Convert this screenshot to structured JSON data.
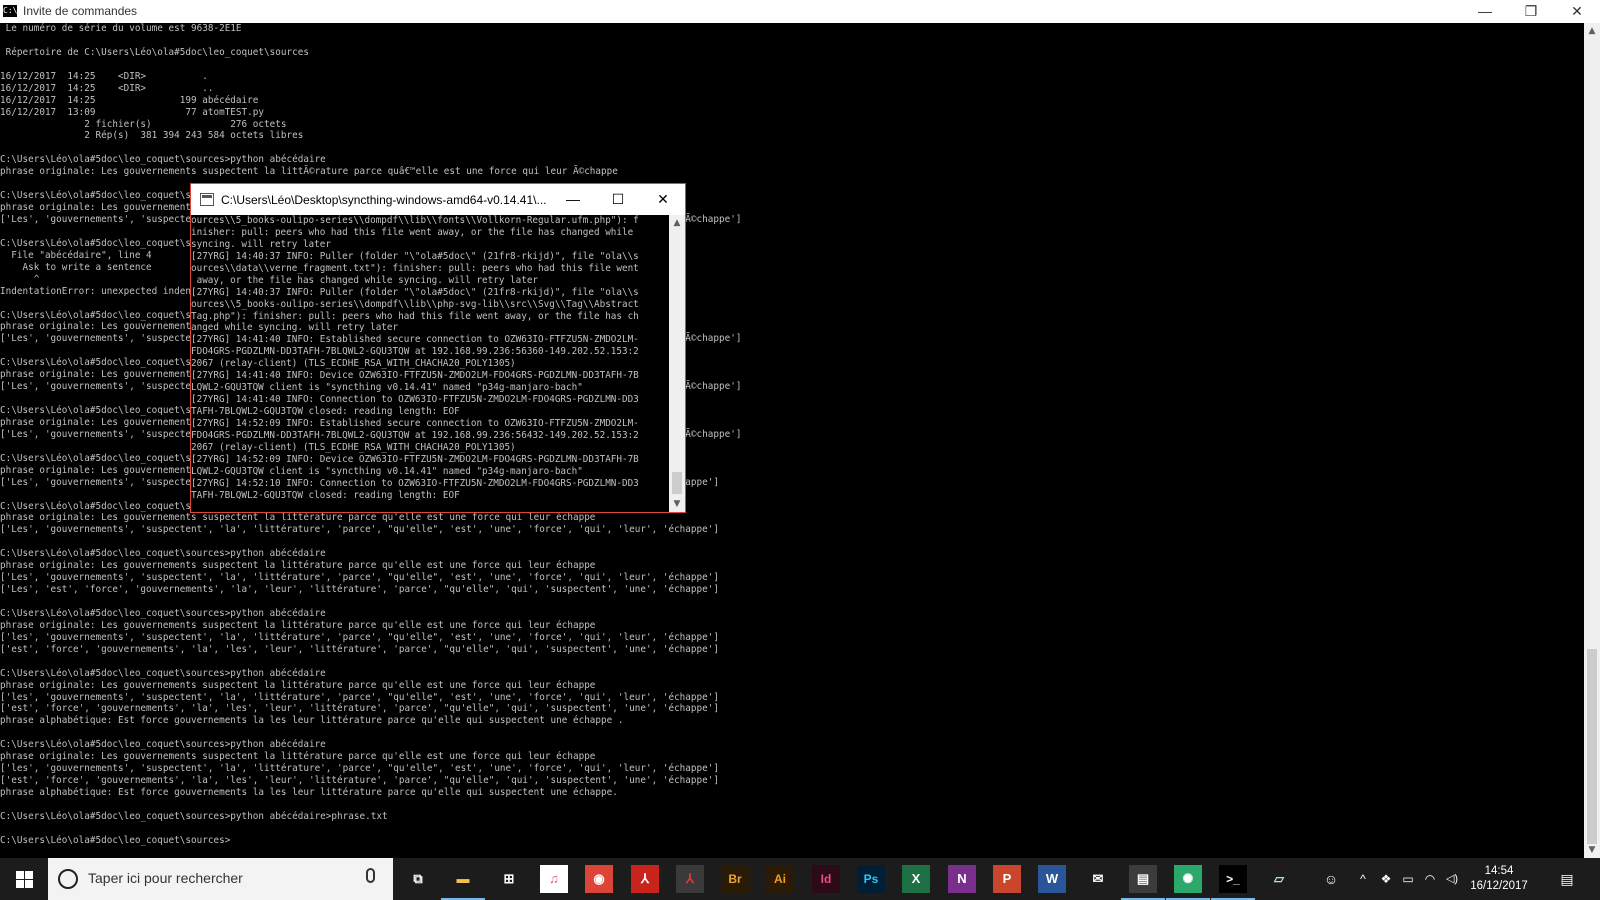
{
  "window": {
    "title": "Invite de commandes",
    "app_icon_label": "C:\\",
    "minimize_glyph": "—",
    "restore_glyph": "❐",
    "close_glyph": "✕"
  },
  "console_lines": [
    " Le numéro de série du volume est 9638-2E1E",
    "",
    " Répertoire de C:\\Users\\Léo\\ola#5doc\\leo_coquet\\sources",
    "",
    "16/12/2017  14:25    <DIR>          .",
    "16/12/2017  14:25    <DIR>          ..",
    "16/12/2017  14:25               199 abécédaire",
    "16/12/2017  13:09                77 atomTEST.py",
    "               2 fichier(s)              276 octets",
    "               2 Rép(s)  381 394 243 584 octets libres",
    "",
    "C:\\Users\\Léo\\ola#5doc\\leo_coquet\\sources>python abécédaire",
    "phrase originale: Les gouvernements suspectent la littÃ©rature parce quâ€™elle est une force qui leur Ã©chappe",
    "",
    "C:\\Users\\Léo\\ola#5doc\\leo_coquet\\sources>python abécédaire",
    "phrase originale: Les gouvernements suspectent la littÃ©rature parce quâ€™elle est une force qui leur Ã©chappe",
    "['Les', 'gouvernements', 'suspectent', 'la', 'littÃ©rature', 'parce', 'quâ€™elle', 'est', 'une', 'force', 'qui', 'leur', 'Ã©chappe']",
    "",
    "C:\\Users\\Léo\\ola#5doc\\leo_coquet\\sources>python abécédaire",
    "  File \"abécédaire\", line 4",
    "    Ask to write a sentence",
    "      ^",
    "IndentationError: unexpected indent",
    "",
    "C:\\Users\\Léo\\ola#5doc\\leo_coquet\\sources>python abécédaire",
    "phrase originale: Les gouvernements suspectent la littÃ©rature parce quâ€™elle est une force qui leur Ã©chappe",
    "['Les', 'gouvernements', 'suspectent', 'la', 'littÃ©rature', 'parce', 'quâ€™elle', 'est', 'une', 'force', 'qui', 'leur', 'Ã©chappe']",
    "",
    "C:\\Users\\Léo\\ola#5doc\\leo_coquet\\sources>python abécédaire",
    "phrase originale: Les gouvernements suspectent la littÃ©rature parce quâ€™elle est une force qui leur Ã©chappe",
    "['Les', 'gouvernements', 'suspectent', 'la', 'littÃ©rature', 'parce', 'quâ€™elle', 'est', 'une', 'force', 'qui', 'leur', 'Ã©chappe']",
    "",
    "C:\\Users\\Léo\\ola#5doc\\leo_coquet\\sources>python abécédaire",
    "phrase originale: Les gouvernements suspectent la littÃ©rature parce quâ€™elle est une force qui leur Ã©chappe",
    "['Les', 'gouvernements', 'suspectent', 'la', 'littÃ©rature', 'parce', 'quâ€™elle', 'est', 'une', 'force', 'qui', 'leur', 'Ã©chappe']",
    "",
    "C:\\Users\\Léo\\ola#5doc\\leo_coquet\\sources>python abécédaire",
    "phrase originale: Les gouvernements suspectent la littérature parce qu'elle est une force qui leur échappe",
    "['Les', 'gouvernements', 'suspectent', 'la', 'littérature', 'parce', \"qu'elle\", 'est', 'une', 'force', 'qui', 'leur', 'échappe']",
    "",
    "C:\\Users\\Léo\\ola#5doc\\leo_coquet\\sources>python abécédaire",
    "phrase originale: Les gouvernements suspectent la littérature parce qu'elle est une force qui leur échappe",
    "['Les', 'gouvernements', 'suspectent', 'la', 'littérature', 'parce', \"qu'elle\", 'est', 'une', 'force', 'qui', 'leur', 'échappe']",
    "",
    "C:\\Users\\Léo\\ola#5doc\\leo_coquet\\sources>python abécédaire",
    "phrase originale: Les gouvernements suspectent la littérature parce qu'elle est une force qui leur échappe",
    "['Les', 'gouvernements', 'suspectent', 'la', 'littérature', 'parce', \"qu'elle\", 'est', 'une', 'force', 'qui', 'leur', 'échappe']",
    "['Les', 'est', 'force', 'gouvernements', 'la', 'leur', 'littérature', 'parce', \"qu'elle\", 'qui', 'suspectent', 'une', 'échappe']",
    "",
    "C:\\Users\\Léo\\ola#5doc\\leo_coquet\\sources>python abécédaire",
    "phrase originale: Les gouvernements suspectent la littérature parce qu'elle est une force qui leur échappe",
    "['les', 'gouvernements', 'suspectent', 'la', 'littérature', 'parce', \"qu'elle\", 'est', 'une', 'force', 'qui', 'leur', 'échappe']",
    "['est', 'force', 'gouvernements', 'la', 'les', 'leur', 'littérature', 'parce', \"qu'elle\", 'qui', 'suspectent', 'une', 'échappe']",
    "",
    "C:\\Users\\Léo\\ola#5doc\\leo_coquet\\sources>python abécédaire",
    "phrase originale: Les gouvernements suspectent la littérature parce qu'elle est une force qui leur échappe",
    "['les', 'gouvernements', 'suspectent', 'la', 'littérature', 'parce', \"qu'elle\", 'est', 'une', 'force', 'qui', 'leur', 'échappe']",
    "['est', 'force', 'gouvernements', 'la', 'les', 'leur', 'littérature', 'parce', \"qu'elle\", 'qui', 'suspectent', 'une', 'échappe']",
    "phrase alphabétique: Est force gouvernements la les leur littérature parce qu'elle qui suspectent une échappe .",
    "",
    "C:\\Users\\Léo\\ola#5doc\\leo_coquet\\sources>python abécédaire",
    "phrase originale: Les gouvernements suspectent la littérature parce qu'elle est une force qui leur échappe",
    "['les', 'gouvernements', 'suspectent', 'la', 'littérature', 'parce', \"qu'elle\", 'est', 'une', 'force', 'qui', 'leur', 'échappe']",
    "['est', 'force', 'gouvernements', 'la', 'les', 'leur', 'littérature', 'parce', \"qu'elle\", 'qui', 'suspectent', 'une', 'échappe']",
    "phrase alphabétique: Est force gouvernements la les leur littérature parce qu'elle qui suspectent une échappe.",
    "",
    "C:\\Users\\Léo\\ola#5doc\\leo_coquet\\sources>python abécédaire>phrase.txt",
    "",
    "C:\\Users\\Léo\\ola#5doc\\leo_coquet\\sources>"
  ],
  "scrollbar": {
    "up_glyph": "▲",
    "down_glyph": "▼"
  },
  "popup": {
    "title": "C:\\Users\\Léo\\Desktop\\syncthing-windows-amd64-v0.14.41\\...",
    "minimize_glyph": "—",
    "maximize_glyph": "☐",
    "close_glyph": "✕",
    "lines": [
      "ources\\\\5_books-oulipo-series\\\\dompdf\\\\lib\\\\fonts\\\\Vollkorn-Regular.ufm.php\"): f",
      "inisher: pull: peers who had this file went away, or the file has changed while",
      "syncing. will retry later",
      "[27YRG] 14:40:37 INFO: Puller (folder \"\\\"ola#5doc\\\" (21fr8-rkijd)\", file \"ola\\\\s",
      "ources\\\\data\\\\verne_fragment.txt\"): finisher: pull: peers who had this file went",
      " away, or the file has changed while syncing. will retry later",
      "[27YRG] 14:40:37 INFO: Puller (folder \"\\\"ola#5doc\\\" (21fr8-rkijd)\", file \"ola\\\\s",
      "ources\\\\5_books-oulipo-series\\\\dompdf\\\\lib\\\\php-svg-lib\\\\src\\\\Svg\\\\Tag\\\\Abstract",
      "Tag.php\"): finisher: pull: peers who had this file went away, or the file has ch",
      "anged while syncing. will retry later",
      "[27YRG] 14:41:40 INFO: Established secure connection to OZW63IO-FTFZU5N-ZMDO2LM-",
      "FDO4GRS-PGDZLMN-DD3TAFH-7BLQWL2-GQU3TQW at 192.168.99.236:56360-149.202.52.153:2",
      "2067 (relay-client) (TLS_ECDHE_RSA_WITH_CHACHA20_POLY1305)",
      "[27YRG] 14:41:40 INFO: Device OZW63IO-FTFZU5N-ZMDO2LM-FDO4GRS-PGDZLMN-DD3TAFH-7B",
      "LQWL2-GQU3TQW client is \"syncthing v0.14.41\" named \"p34g-manjaro-bach\"",
      "[27YRG] 14:41:40 INFO: Connection to OZW63IO-FTFZU5N-ZMDO2LM-FDO4GRS-PGDZLMN-DD3",
      "TAFH-7BLQWL2-GQU3TQW closed: reading length: EOF",
      "[27YRG] 14:52:09 INFO: Established secure connection to OZW63IO-FTFZU5N-ZMDO2LM-",
      "FDO4GRS-PGDZLMN-DD3TAFH-7BLQWL2-GQU3TQW at 192.168.99.236:56432-149.202.52.153:2",
      "2067 (relay-client) (TLS_ECDHE_RSA_WITH_CHACHA20_POLY1305)",
      "[27YRG] 14:52:09 INFO: Device OZW63IO-FTFZU5N-ZMDO2LM-FDO4GRS-PGDZLMN-DD3TAFH-7B",
      "LQWL2-GQU3TQW client is \"syncthing v0.14.41\" named \"p34g-manjaro-bach\"",
      "[27YRG] 14:52:10 INFO: Connection to OZW63IO-FTFZU5N-ZMDO2LM-FDO4GRS-PGDZLMN-DD3",
      "TAFH-7BLQWL2-GQU3TQW closed: reading length: EOF"
    ]
  },
  "taskbar": {
    "search_placeholder": "Taper ici pour rechercher",
    "apps": [
      {
        "name": "task-view",
        "glyph": "⧉",
        "color": "#ffffff",
        "bg": "#1c1c1c"
      },
      {
        "name": "file-explorer",
        "glyph": "▬",
        "color": "#f0c14b",
        "bg": "#1c1c1c"
      },
      {
        "name": "store",
        "glyph": "⊞",
        "color": "#ffffff",
        "bg": "#1c1c1c"
      },
      {
        "name": "itunes",
        "glyph": "♫",
        "color": "#e0509e",
        "bg": "#ffffff"
      },
      {
        "name": "chrome",
        "glyph": "◉",
        "color": "#ffffff",
        "bg": "#db4437"
      },
      {
        "name": "adobe-reader",
        "glyph": "⅄",
        "color": "#ffffff",
        "bg": "#c8241c"
      },
      {
        "name": "acrobat",
        "glyph": "⅄",
        "color": "#e03a2e",
        "bg": "#3a3a3a"
      },
      {
        "name": "bridge",
        "glyph": "Br",
        "color": "#e8a33a",
        "bg": "#2a1b07"
      },
      {
        "name": "illustrator",
        "glyph": "Ai",
        "color": "#f39c1f",
        "bg": "#2b1a05"
      },
      {
        "name": "indesign",
        "glyph": "Id",
        "color": "#ef4a87",
        "bg": "#2c0a18"
      },
      {
        "name": "photoshop",
        "glyph": "Ps",
        "color": "#31c5f0",
        "bg": "#001e36"
      },
      {
        "name": "excel",
        "glyph": "X",
        "color": "#ffffff",
        "bg": "#1d7044"
      },
      {
        "name": "onenote",
        "glyph": "N",
        "color": "#ffffff",
        "bg": "#7a2f8c"
      },
      {
        "name": "powerpoint",
        "glyph": "P",
        "color": "#ffffff",
        "bg": "#c9452b"
      },
      {
        "name": "word",
        "glyph": "W",
        "color": "#ffffff",
        "bg": "#2a5699"
      },
      {
        "name": "mail",
        "glyph": "✉",
        "color": "#ffffff",
        "bg": "#1c1c1c"
      },
      {
        "name": "notepad",
        "glyph": "▤",
        "color": "#ffffff",
        "bg": "#3c3c3c"
      },
      {
        "name": "syncthing",
        "glyph": "✺",
        "color": "#ffffff",
        "bg": "#2ca86a"
      },
      {
        "name": "command-prompt",
        "glyph": ">_",
        "color": "#ffffff",
        "bg": "#000000"
      },
      {
        "name": "notes",
        "glyph": "▱",
        "color": "#a6e0ff",
        "bg": "#1c1c1c"
      }
    ],
    "tray": {
      "people_glyph": "☺",
      "chevron_glyph": "^",
      "dropbox_glyph": "❖",
      "battery_glyph": "▭",
      "wifi_glyph": "◠",
      "volume_glyph": "◁)",
      "notifications_glyph": "▤"
    },
    "clock": {
      "time": "14:54",
      "date": "16/12/2017"
    }
  }
}
